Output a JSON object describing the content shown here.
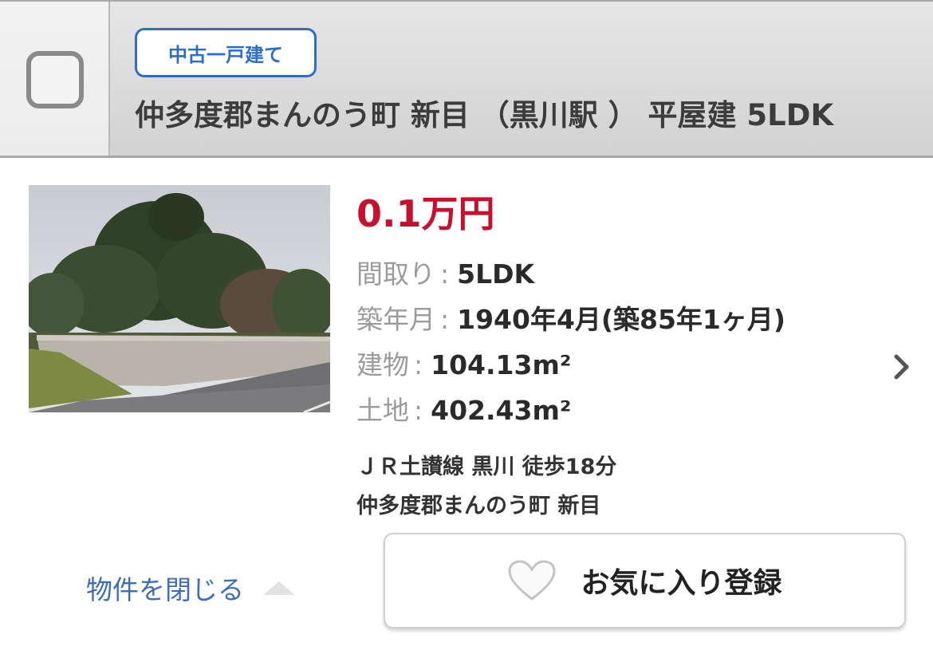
{
  "header": {
    "badge": "中古一戸建て",
    "title": "仲多度郡まんのう町 新目 （黒川駅 ） 平屋建 5LDK"
  },
  "listing": {
    "price": "0.1万円",
    "specs": [
      {
        "key": "間取り",
        "value": "5LDK"
      },
      {
        "key": "築年月",
        "value": "1940年4月(築85年1ヶ月)"
      },
      {
        "key": "建物",
        "value": "104.13m²"
      },
      {
        "key": "土地",
        "value": "402.43m²"
      }
    ],
    "separator": ":",
    "access_line": "ＪＲ土讃線 黒川 徒歩18分",
    "address": "仲多度郡まんのう町 新目"
  },
  "actions": {
    "close_label": "物件を閉じる",
    "favorite_label": "お気に入り登録"
  },
  "icons": {
    "checkbox": "checkbox-unchecked",
    "chevron": "chevron-right-icon",
    "collapse": "chevron-up-icon",
    "favorite": "heart-outline-icon"
  },
  "colors": {
    "price": "#c8102e",
    "badge": "#2d6ec9",
    "link": "#3d6fb6"
  }
}
